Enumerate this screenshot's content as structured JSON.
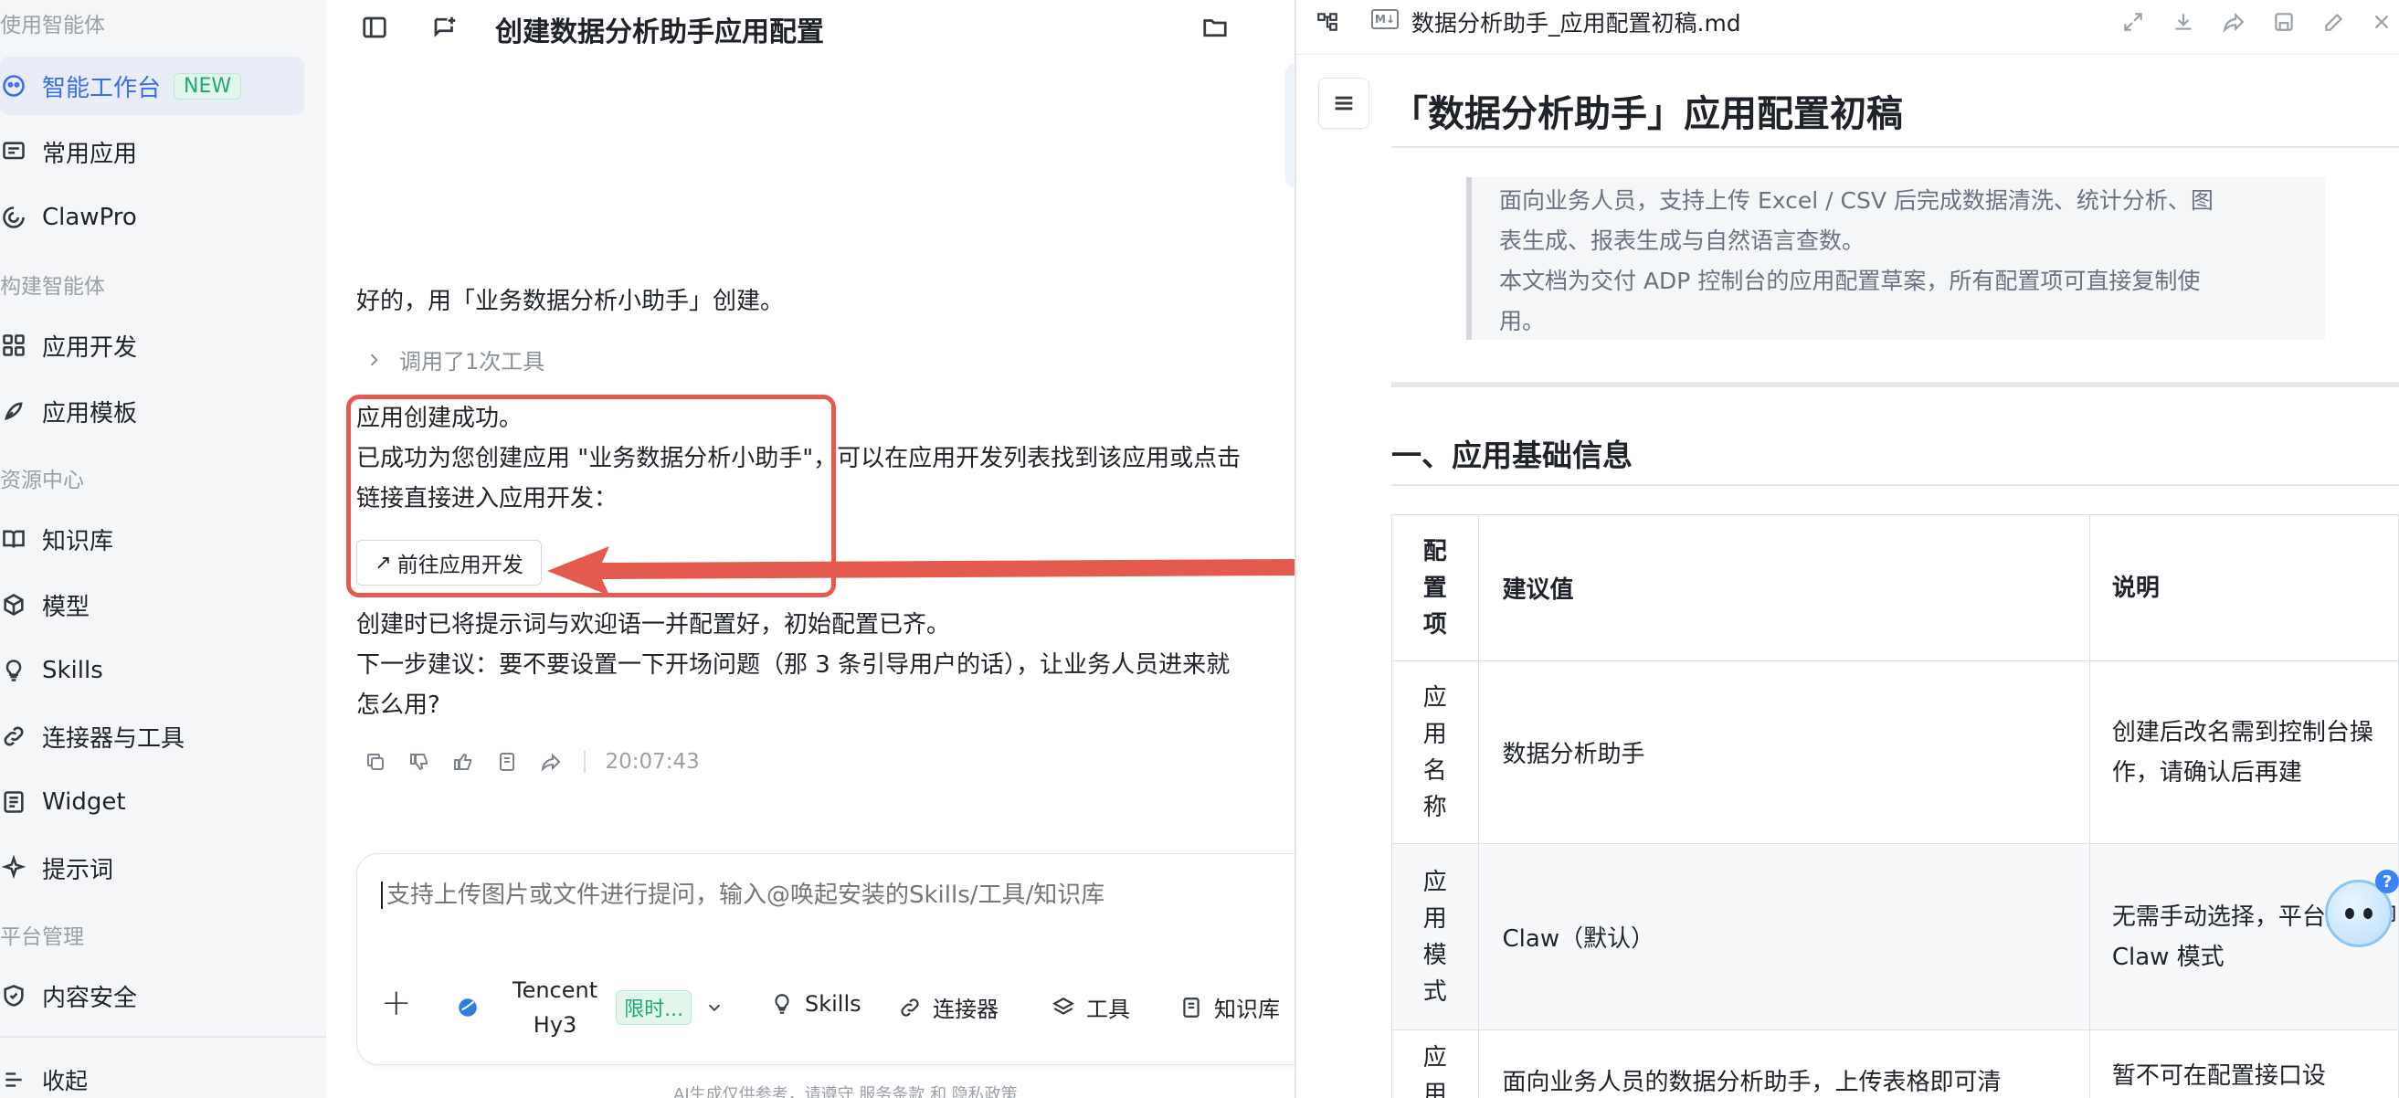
{
  "sidebar": {
    "sections": {
      "agents": "使用智能体",
      "build": "构建智能体",
      "resources": "资源中心",
      "platform": "平台管理"
    },
    "items": [
      {
        "label": "智能工作台",
        "icon": "workspace-icon",
        "badge": "NEW",
        "active": true
      },
      {
        "label": "常用应用",
        "icon": "chat-apps-icon"
      },
      {
        "label": "ClawPro",
        "icon": "clawpro-icon"
      },
      {
        "label": "应用开发",
        "icon": "grid-icon"
      },
      {
        "label": "应用模板",
        "icon": "template-icon"
      },
      {
        "label": "知识库",
        "icon": "book-icon"
      },
      {
        "label": "模型",
        "icon": "cube-icon"
      },
      {
        "label": "Skills",
        "icon": "bulb-icon"
      },
      {
        "label": "连接器与工具",
        "icon": "link-icon"
      },
      {
        "label": "Widget",
        "icon": "widget-icon"
      },
      {
        "label": "提示词",
        "icon": "sparkle-icon"
      },
      {
        "label": "内容安全",
        "icon": "shield-icon"
      }
    ],
    "collapse_label": "收起"
  },
  "chat": {
    "title": "创建数据分析助手应用配置",
    "reply_intro": "好的，用「业务数据分析小助手」创建。",
    "tool_call": "调用了1次工具",
    "result_lines": [
      "应用创建成功。",
      "已成功为您创建应用 \"业务数据分析小助手\"，可以在应用开发列表找到该应用或点击",
      "链接直接进入应用开发："
    ],
    "go_button": "前往应用开发",
    "followup_lines": [
      "创建时已将提示词与欢迎语一并配置好，初始配置已齐。",
      "下一步建议：要不要设置一下开场问题（那 3 条引导用户的话），让业务人员进来就",
      "怎么用?"
    ],
    "timestamp": "20:07:43",
    "composer": {
      "placeholder": "支持上传图片或文件进行提问，输入@唤起安装的Skills/工具/知识库",
      "model_line1": "Tencent",
      "model_line2": "Hy3",
      "limit_badge": "限时...",
      "skills": "Skills",
      "connectors": "连接器",
      "tools": "工具",
      "knowledge": "知识库"
    },
    "footer_note": "AI生成仅供参考，请遵守 服务条款 和 隐私政策"
  },
  "doc": {
    "file_badge": "M↓",
    "filename": "数据分析助手_应用配置初稿.md",
    "h1": "「数据分析助手」应用配置初稿",
    "quote_lines": [
      "面向业务人员，支持上传 Excel / CSV 后完成数据清洗、统计分析、图",
      "表生成、报表生成与自然语言查数。",
      "本文档为交付 ADP 控制台的应用配置草案，所有配置项可直接复制使",
      "用。"
    ],
    "h2": "一、应用基础信息",
    "table": {
      "headers": [
        "配置项",
        "建议值",
        "说明"
      ],
      "rows": [
        [
          "应用名称",
          "数据分析助手",
          "创建后改名需到控制台操作，请确认后再建"
        ],
        [
          "应用模式",
          "Claw（默认）",
          "无需手动选择，平台默认即 Claw 模式"
        ],
        [
          "应用",
          "面向业务人员的数据分析助手，上传表格即可清",
          "暂不可在配置接口设"
        ]
      ]
    }
  },
  "colors": {
    "accent": "#3b6df0",
    "annotation": "#e45a4e",
    "badge_green": "#1fa971"
  }
}
